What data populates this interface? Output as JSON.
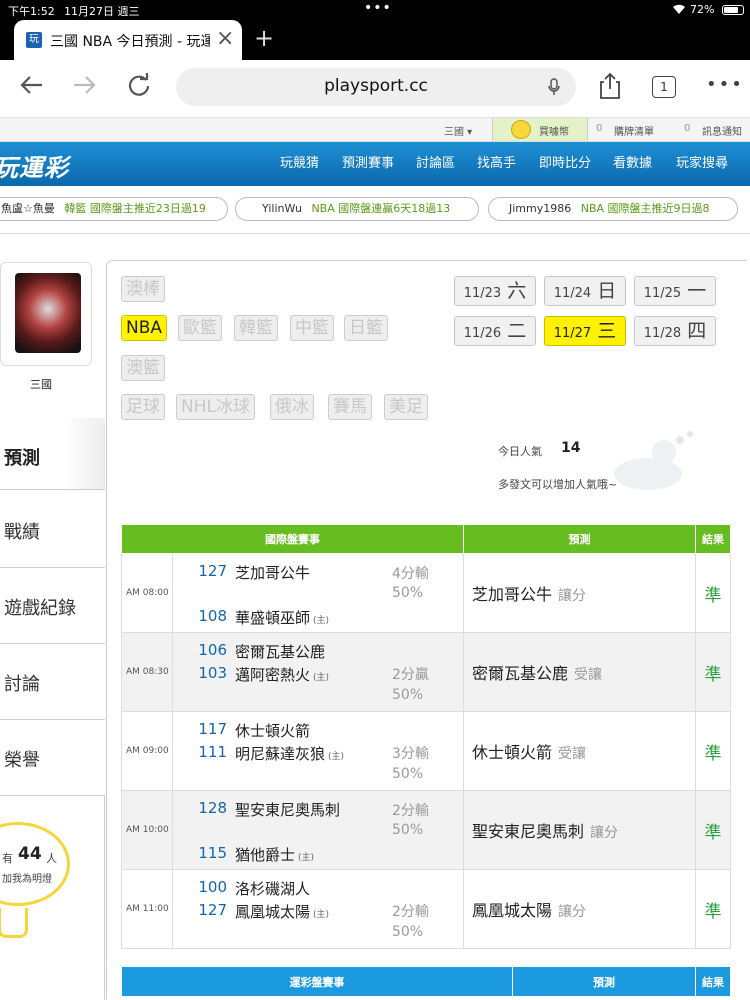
{
  "status_bar": {
    "time": "下午1:52",
    "date": "11月27日 週三",
    "battery": "72%"
  },
  "browser": {
    "tab_title": "三國 NBA 今日預測 - 玩運",
    "tab_icon": "玩",
    "url": "playsport.cc",
    "tab_count": "1"
  },
  "topstrip": {
    "user_menu": "三國 ▾",
    "coins_label": "買噱幣",
    "cart_count": "0",
    "cart_label": "購牌清單",
    "msg_count": "0",
    "msg_label": "訊息通知"
  },
  "nav": {
    "logo": "玩運彩",
    "items": [
      "玩競猜",
      "預測賽事",
      "討論區",
      "找高手",
      "即時比分",
      "看數據",
      "玩家搜尋"
    ]
  },
  "tickers": [
    {
      "user": "魚盧☆魚曼",
      "text": "韓籃  國際盤主推近23日過19"
    },
    {
      "user": "YilinWu",
      "text": "NBA  國際盤連贏6天18過13"
    },
    {
      "user": "Jimmy1986",
      "text": "NBA  國際盤主推近9日過8"
    }
  ],
  "profile": {
    "name": "三國",
    "light_prefix": "有",
    "light_count": "44",
    "light_suffix": "人",
    "light_text": "加我為明燈"
  },
  "menu": {
    "heading": "預測",
    "items": [
      "戰績",
      "遊戲紀錄",
      "討論",
      "榮譽"
    ]
  },
  "leagues": [
    "澳棒",
    "NBA",
    "歐籃",
    "韓籃",
    "中籃",
    "日籃",
    "澳籃",
    "足球",
    "NHL冰球",
    "俄冰",
    "賽馬",
    "美足"
  ],
  "active_league": "NBA",
  "dates": [
    {
      "d": "11/23",
      "w": "六"
    },
    {
      "d": "11/24",
      "w": "日"
    },
    {
      "d": "11/25",
      "w": "一"
    },
    {
      "d": "11/26",
      "w": "二"
    },
    {
      "d": "11/27",
      "w": "三"
    },
    {
      "d": "11/28",
      "w": "四"
    }
  ],
  "active_date": "11/27",
  "popularity": {
    "label": "今日人氣",
    "value": "14",
    "hint": "多發文可以增加人氣哦~"
  },
  "intl_table": {
    "headers": [
      "國際盤賽事",
      "預測",
      "結果"
    ],
    "home_mark": "(主)",
    "rows": [
      {
        "time": "AM 08:00",
        "away_num": "127",
        "away": "芝加哥公牛",
        "home_num": "108",
        "home": "華盛頓巫師",
        "spread1": "4分輸",
        "spread2": "50%",
        "pick": "芝加哥公牛",
        "pick_type": "讓分",
        "result": "準"
      },
      {
        "time": "AM 08:30",
        "away_num": "106",
        "away": "密爾瓦基公鹿",
        "home_num": "103",
        "home": "邁阿密熱火",
        "spread1": "2分贏",
        "spread2": "50%",
        "pick": "密爾瓦基公鹿",
        "pick_type": "受讓",
        "result": "準"
      },
      {
        "time": "AM 09:00",
        "away_num": "117",
        "away": "休士頓火箭",
        "home_num": "111",
        "home": "明尼蘇達灰狼",
        "spread1": "3分輸",
        "spread2": "50%",
        "pick": "休士頓火箭",
        "pick_type": "受讓",
        "result": "準"
      },
      {
        "time": "AM 10:00",
        "away_num": "128",
        "away": "聖安東尼奧馬刺",
        "home_num": "115",
        "home": "猶他爵士",
        "spread1": "2分輸",
        "spread2": "50%",
        "pick": "聖安東尼奧馬刺",
        "pick_type": "讓分",
        "result": "準"
      },
      {
        "time": "AM 11:00",
        "away_num": "100",
        "away": "洛杉磯湖人",
        "home_num": "127",
        "home": "鳳凰城太陽",
        "spread1": "2分輸",
        "spread2": "50%",
        "pick": "鳳凰城太陽",
        "pick_type": "讓分",
        "result": "準"
      }
    ]
  },
  "sport_table": {
    "headers": [
      "運彩盤賽事",
      "預測",
      "結果"
    ]
  },
  "colors": {
    "nav_blue": "#0b68ad",
    "green_header": "#67bd1f",
    "blue_header": "#1b9adf",
    "highlight_yellow": "#fff200",
    "correct_green": "#2aa13c"
  }
}
